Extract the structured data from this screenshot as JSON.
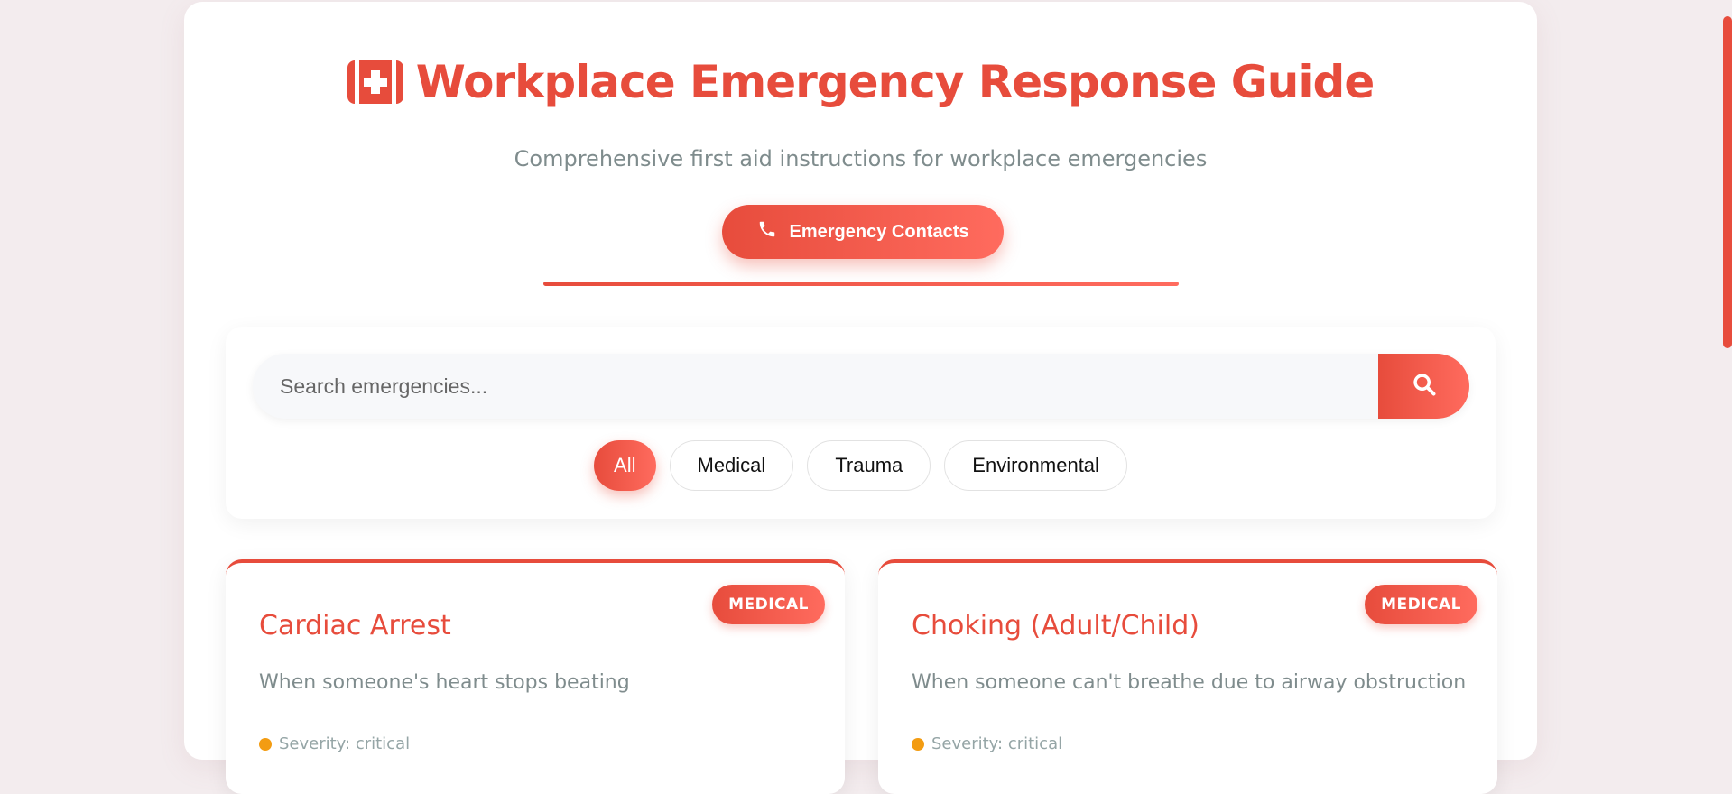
{
  "header": {
    "title": "Workplace Emergency Response Guide",
    "subtitle": "Comprehensive first aid instructions for workplace emergencies",
    "contacts_button": "Emergency Contacts"
  },
  "search": {
    "placeholder": "Search emergencies...",
    "value": ""
  },
  "filters": [
    "All",
    "Medical",
    "Trauma",
    "Environmental"
  ],
  "active_filter": "All",
  "cards": [
    {
      "badge": "MEDICAL",
      "title": "Cardiac Arrest",
      "description": "When someone's heart stops beating",
      "severity": "Severity: critical"
    },
    {
      "badge": "MEDICAL",
      "title": "Choking (Adult/Child)",
      "description": "When someone can't breathe due to airway obstruction",
      "severity": "Severity: critical"
    }
  ],
  "icons": {
    "title_icon": "first-aid-kit-icon",
    "contacts_icon": "phone-icon",
    "search_icon": "search-icon"
  },
  "colors": {
    "accent": "#e74c3c",
    "accent_light": "#ff6b5e",
    "severity_dot": "#f39c12",
    "page_bg": "#f3ecee"
  }
}
